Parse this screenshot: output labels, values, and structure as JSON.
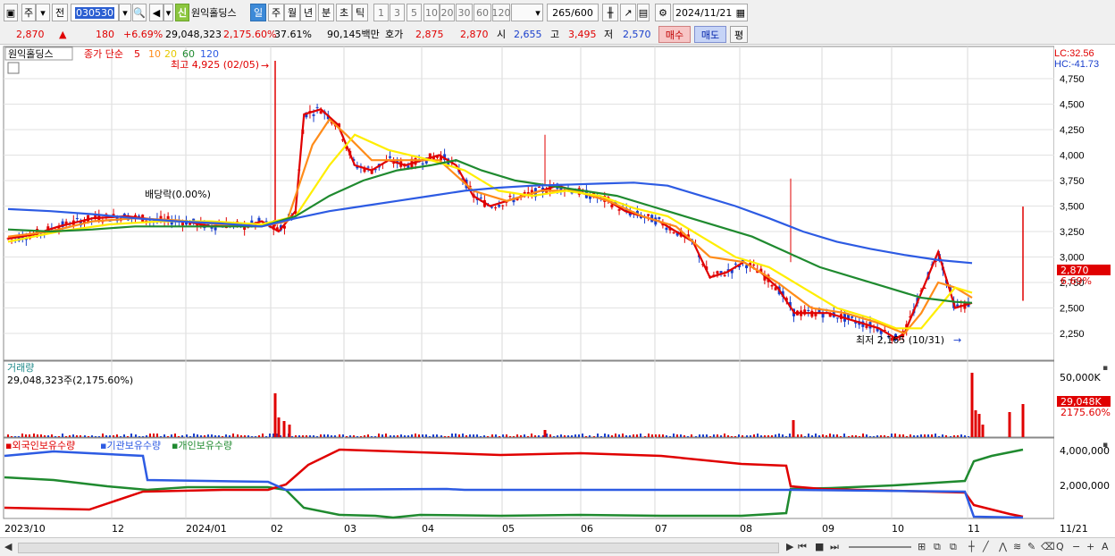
{
  "toolbar": {
    "market_label": "주",
    "prev_label": "전",
    "stock_code": "030530",
    "new_badge": "신",
    "stock_name": "원익홀딩스",
    "period_tabs": [
      "일",
      "주",
      "월",
      "년",
      "분",
      "초",
      "틱"
    ],
    "selected_period": "일",
    "interval_buttons": [
      "1",
      "3",
      "5",
      "10",
      "20",
      "30",
      "60",
      "120"
    ],
    "count_value": "265",
    "count_total": "/600",
    "date_value": "2024/11/21"
  },
  "quote": {
    "price": "2,870",
    "change": "180",
    "change_pct": "+6.69%",
    "volume": "29,048,323",
    "volume_ratio": "2,175.60%",
    "turnover": "37.61%",
    "amount": "90,145백만",
    "bid_label": "호가",
    "ask": "2,875",
    "bid": "2,870",
    "open_label": "시",
    "open": "2,655",
    "high_label": "고",
    "high": "3,495",
    "low_label": "저",
    "low": "2,570",
    "buy_button": "매수",
    "sell_button": "매도",
    "eval_button": "평"
  },
  "chart_data": {
    "type": "candlestick",
    "stock": "원익홀딩스",
    "price_legend": {
      "label": "종가 단순",
      "periods": [
        "5",
        "10",
        "20",
        "60",
        "120"
      ]
    },
    "price_axis_ticks": [
      "4,750",
      "4,500",
      "4,250",
      "4,000",
      "3,750",
      "3,500",
      "3,250",
      "3,000",
      "2,750",
      "2,500",
      "2,250"
    ],
    "x_axis_labels": [
      "2023/10",
      "12",
      "2024/01",
      "02",
      "03",
      "04",
      "05",
      "06",
      "07",
      "08",
      "09",
      "10",
      "11",
      "11/21"
    ],
    "lc": "LC:32.56",
    "hc": "HC:-41.73",
    "current_price_label": "2,870",
    "current_change_label": "6.69%",
    "annotations": {
      "high": "최고 4,925 (02/05)",
      "low": "최저 2,165 (10/31)",
      "dividend": "배당락(0.00%)"
    },
    "ma_series": [
      {
        "name": "5",
        "color": "#e00000",
        "points": [
          [
            0,
            3180
          ],
          [
            0.03,
            3220
          ],
          [
            0.06,
            3300
          ],
          [
            0.1,
            3380
          ],
          [
            0.14,
            3400
          ],
          [
            0.18,
            3360
          ],
          [
            0.21,
            3350
          ],
          [
            0.24,
            3300
          ],
          [
            0.26,
            3320
          ],
          [
            0.28,
            3300
          ],
          [
            0.3,
            3350
          ],
          [
            0.32,
            3250
          ],
          [
            0.34,
            3450
          ],
          [
            0.35,
            4400
          ],
          [
            0.37,
            4450
          ],
          [
            0.39,
            4300
          ],
          [
            0.41,
            3900
          ],
          [
            0.43,
            3850
          ],
          [
            0.45,
            3950
          ],
          [
            0.47,
            3900
          ],
          [
            0.49,
            3950
          ],
          [
            0.51,
            4000
          ],
          [
            0.53,
            3900
          ],
          [
            0.55,
            3600
          ],
          [
            0.57,
            3500
          ],
          [
            0.59,
            3550
          ],
          [
            0.61,
            3600
          ],
          [
            0.63,
            3650
          ],
          [
            0.65,
            3700
          ],
          [
            0.67,
            3650
          ],
          [
            0.69,
            3600
          ],
          [
            0.71,
            3550
          ],
          [
            0.73,
            3450
          ],
          [
            0.75,
            3400
          ],
          [
            0.77,
            3350
          ],
          [
            0.79,
            3250
          ],
          [
            0.81,
            3150
          ],
          [
            0.83,
            2800
          ],
          [
            0.85,
            2850
          ],
          [
            0.87,
            2950
          ],
          [
            0.89,
            2850
          ],
          [
            0.91,
            2700
          ],
          [
            0.93,
            2450
          ],
          [
            0.95,
            2450
          ],
          [
            0.97,
            2450
          ],
          [
            0.99,
            2400
          ],
          [
            1.01,
            2350
          ],
          [
            1.03,
            2300
          ],
          [
            1.05,
            2200
          ],
          [
            1.06,
            2250
          ],
          [
            1.08,
            2650
          ],
          [
            1.1,
            3050
          ],
          [
            1.12,
            2500
          ],
          [
            1.14,
            2550
          ]
        ]
      },
      {
        "name": "10",
        "color": "#ff8c1a",
        "points": [
          [
            0,
            3200
          ],
          [
            0.05,
            3250
          ],
          [
            0.1,
            3350
          ],
          [
            0.15,
            3380
          ],
          [
            0.2,
            3360
          ],
          [
            0.25,
            3320
          ],
          [
            0.3,
            3300
          ],
          [
            0.33,
            3350
          ],
          [
            0.36,
            4100
          ],
          [
            0.38,
            4350
          ],
          [
            0.4,
            4200
          ],
          [
            0.43,
            3950
          ],
          [
            0.47,
            3950
          ],
          [
            0.51,
            3950
          ],
          [
            0.55,
            3650
          ],
          [
            0.59,
            3550
          ],
          [
            0.63,
            3650
          ],
          [
            0.67,
            3650
          ],
          [
            0.71,
            3550
          ],
          [
            0.75,
            3400
          ],
          [
            0.79,
            3300
          ],
          [
            0.83,
            3000
          ],
          [
            0.87,
            2950
          ],
          [
            0.91,
            2750
          ],
          [
            0.95,
            2500
          ],
          [
            0.99,
            2450
          ],
          [
            1.03,
            2350
          ],
          [
            1.06,
            2250
          ],
          [
            1.08,
            2450
          ],
          [
            1.1,
            2750
          ],
          [
            1.12,
            2700
          ],
          [
            1.14,
            2600
          ]
        ]
      },
      {
        "name": "20",
        "color": "#ffee00",
        "points": [
          [
            0,
            3150
          ],
          [
            0.06,
            3250
          ],
          [
            0.12,
            3320
          ],
          [
            0.18,
            3350
          ],
          [
            0.24,
            3350
          ],
          [
            0.3,
            3320
          ],
          [
            0.34,
            3400
          ],
          [
            0.38,
            3900
          ],
          [
            0.41,
            4200
          ],
          [
            0.45,
            4050
          ],
          [
            0.5,
            3950
          ],
          [
            0.54,
            3850
          ],
          [
            0.58,
            3650
          ],
          [
            0.62,
            3600
          ],
          [
            0.66,
            3650
          ],
          [
            0.7,
            3600
          ],
          [
            0.74,
            3480
          ],
          [
            0.78,
            3400
          ],
          [
            0.82,
            3200
          ],
          [
            0.86,
            3000
          ],
          [
            0.9,
            2900
          ],
          [
            0.94,
            2700
          ],
          [
            0.98,
            2500
          ],
          [
            1.02,
            2400
          ],
          [
            1.05,
            2300
          ],
          [
            1.08,
            2300
          ],
          [
            1.1,
            2500
          ],
          [
            1.12,
            2700
          ],
          [
            1.14,
            2650
          ]
        ]
      },
      {
        "name": "60",
        "color": "#1f8a2f",
        "points": [
          [
            0,
            3270
          ],
          [
            0.05,
            3250
          ],
          [
            0.1,
            3270
          ],
          [
            0.15,
            3300
          ],
          [
            0.2,
            3300
          ],
          [
            0.25,
            3300
          ],
          [
            0.3,
            3300
          ],
          [
            0.34,
            3400
          ],
          [
            0.38,
            3600
          ],
          [
            0.42,
            3750
          ],
          [
            0.46,
            3850
          ],
          [
            0.5,
            3900
          ],
          [
            0.53,
            3950
          ],
          [
            0.56,
            3850
          ],
          [
            0.6,
            3750
          ],
          [
            0.64,
            3700
          ],
          [
            0.68,
            3650
          ],
          [
            0.72,
            3600
          ],
          [
            0.76,
            3500
          ],
          [
            0.8,
            3400
          ],
          [
            0.84,
            3300
          ],
          [
            0.88,
            3200
          ],
          [
            0.92,
            3050
          ],
          [
            0.96,
            2900
          ],
          [
            1.0,
            2800
          ],
          [
            1.04,
            2700
          ],
          [
            1.08,
            2600
          ],
          [
            1.1,
            2580
          ],
          [
            1.12,
            2560
          ],
          [
            1.14,
            2550
          ]
        ]
      },
      {
        "name": "120",
        "color": "#2d5be3",
        "points": [
          [
            0,
            3470
          ],
          [
            0.05,
            3450
          ],
          [
            0.1,
            3420
          ],
          [
            0.15,
            3380
          ],
          [
            0.2,
            3350
          ],
          [
            0.25,
            3330
          ],
          [
            0.3,
            3300
          ],
          [
            0.34,
            3380
          ],
          [
            0.38,
            3450
          ],
          [
            0.42,
            3500
          ],
          [
            0.46,
            3550
          ],
          [
            0.5,
            3600
          ],
          [
            0.54,
            3650
          ],
          [
            0.58,
            3680
          ],
          [
            0.62,
            3700
          ],
          [
            0.66,
            3710
          ],
          [
            0.7,
            3720
          ],
          [
            0.74,
            3730
          ],
          [
            0.78,
            3700
          ],
          [
            0.82,
            3600
          ],
          [
            0.86,
            3500
          ],
          [
            0.9,
            3380
          ],
          [
            0.94,
            3250
          ],
          [
            0.98,
            3150
          ],
          [
            1.02,
            3080
          ],
          [
            1.06,
            3020
          ],
          [
            1.1,
            2970
          ],
          [
            1.14,
            2940
          ]
        ]
      }
    ],
    "volume_panel": {
      "label": "거래량",
      "value_text": "29,048,323주(2,175.60%)",
      "axis_ticks": [
        "50,000K"
      ],
      "current_label": "29,048K",
      "current_pct": "2175.60%"
    },
    "holding_panel": {
      "legend": [
        {
          "name": "외국인보유수량",
          "color": "#e00000"
        },
        {
          "name": "기관보유수량",
          "color": "#2d5be3"
        },
        {
          "name": "개인보유수량",
          "color": "#1f8a2f"
        }
      ],
      "axis_ticks": [
        "4,000,000",
        "2,000,000"
      ]
    }
  },
  "statusbar": {
    "scroll_label": "Q",
    "zoom_out": "−",
    "zoom_in": "+",
    "font_label": "A"
  }
}
